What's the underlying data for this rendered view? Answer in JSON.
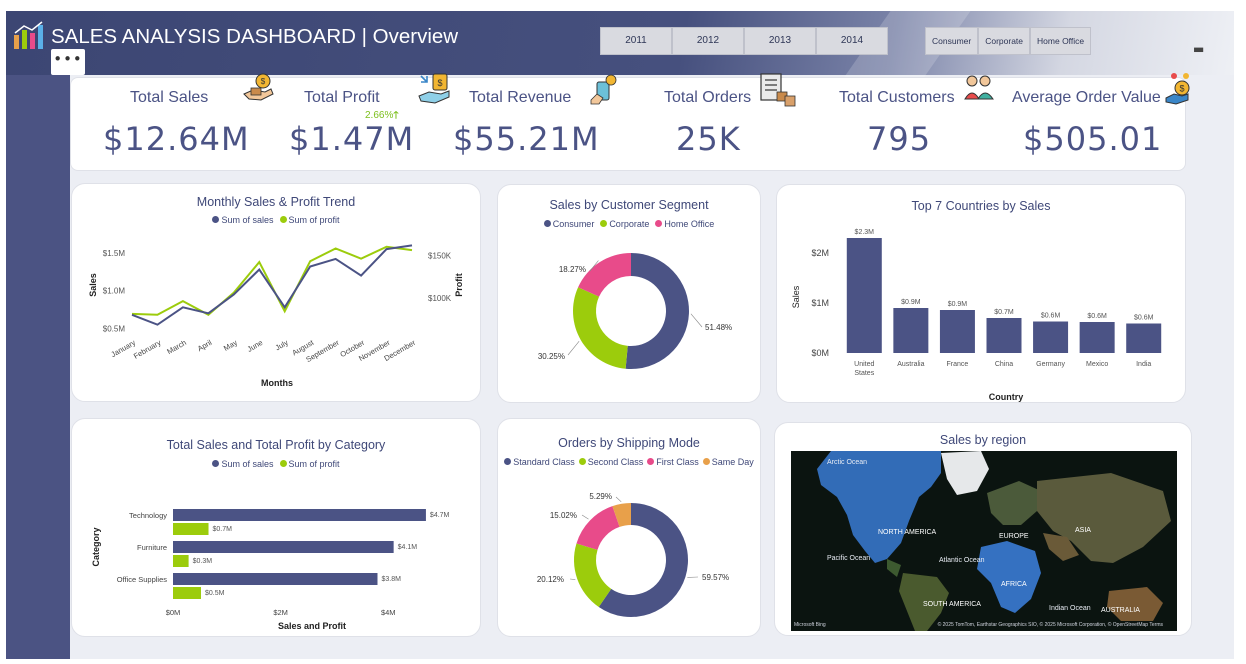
{
  "header": {
    "title": "SALES ANALYSIS DASHBOARD | Overview",
    "years": [
      "2011",
      "2012",
      "2013",
      "2014"
    ],
    "segments": [
      "Consumer",
      "Corporate",
      "Home Office"
    ],
    "more_label": "•••"
  },
  "kpis": [
    {
      "label": "Total Sales",
      "value": "$12.64M",
      "icon": "money-hand-icon"
    },
    {
      "label": "Total Profit",
      "value": "$1.47M",
      "delta": "2.66%",
      "delta_arrow": "🡑",
      "icon": "profit-icon"
    },
    {
      "label": "Total Revenue",
      "value": "$55.21M",
      "icon": "revenue-icon"
    },
    {
      "label": "Total Orders",
      "value": "25K",
      "icon": "orders-icon"
    },
    {
      "label": "Total Customers",
      "value": "795",
      "icon": "customers-icon"
    },
    {
      "label": "Average Order Value",
      "value": "$505.01",
      "icon": "avg-order-icon"
    }
  ],
  "colors": {
    "navy": "#4b5385",
    "green": "#9ccc0c",
    "pink": "#e84b8a",
    "orange": "#e8a04a",
    "accent_text": "#3f4878"
  },
  "chart_data": [
    {
      "type": "line",
      "title": "Monthly Sales & Profit Trend",
      "xlabel": "Months",
      "ylabel": "Sales",
      "y2label": "Profit",
      "categories": [
        "January",
        "February",
        "March",
        "April",
        "May",
        "June",
        "July",
        "August",
        "September",
        "October",
        "November",
        "December"
      ],
      "series": [
        {
          "name": "Sum of sales",
          "axis": "left",
          "values": [
            0.68,
            0.55,
            0.78,
            0.7,
            0.95,
            1.28,
            0.78,
            1.32,
            1.42,
            1.2,
            1.55,
            1.6
          ]
        },
        {
          "name": "Sum of profit",
          "axis": "right",
          "values": [
            81,
            80,
            96,
            80,
            106,
            142,
            84,
            143,
            158,
            146,
            160,
            156
          ]
        }
      ],
      "y_ticks": [
        "$0.5M",
        "$1.0M",
        "$1.5M"
      ],
      "ylim": [
        0.4,
        1.75
      ],
      "y2_ticks": [
        "$100K",
        "$150K"
      ],
      "y2lim": [
        55,
        175
      ]
    },
    {
      "type": "pie",
      "title": "Sales by Customer Segment",
      "categories": [
        "Consumer",
        "Corporate",
        "Home Office"
      ],
      "values": [
        51.48,
        30.25,
        18.27
      ],
      "labels": [
        "51.48%",
        "30.25%",
        "18.27%"
      ]
    },
    {
      "type": "bar",
      "title": "Top 7 Countries by Sales",
      "xlabel": "Country",
      "ylabel": "Sales",
      "categories": [
        "United States",
        "Australia",
        "France",
        "China",
        "Germany",
        "Mexico",
        "India"
      ],
      "category_lines": [
        [
          "United",
          "States"
        ],
        [
          "Australia"
        ],
        [
          "France"
        ],
        [
          "China"
        ],
        [
          "Germany"
        ],
        [
          "Mexico"
        ],
        [
          "India"
        ]
      ],
      "values": [
        2.3,
        0.9,
        0.86,
        0.7,
        0.63,
        0.62,
        0.59
      ],
      "labels": [
        "$2.3M",
        "$0.9M",
        "$0.9M",
        "$0.7M",
        "$0.6M",
        "$0.6M",
        "$0.6M"
      ],
      "y_ticks": [
        {
          "v": 0,
          "t": "$0M"
        },
        {
          "v": 1,
          "t": "$1M"
        },
        {
          "v": 2,
          "t": "$2M"
        }
      ],
      "ylim": [
        0,
        2.5
      ]
    },
    {
      "type": "bar",
      "orientation": "horizontal",
      "title": "Total Sales and Total Profit by Category",
      "xlabel": "Sales and Profit",
      "ylabel": "Category",
      "categories": [
        "Technology",
        "Furniture",
        "Office Supplies"
      ],
      "series": [
        {
          "name": "Sum of sales",
          "values": [
            4.7,
            4.1,
            3.8
          ],
          "labels": [
            "$4.7M",
            "$4.1M",
            "$3.8M"
          ]
        },
        {
          "name": "Sum of profit",
          "values": [
            0.66,
            0.29,
            0.52
          ],
          "labels": [
            "$0.7M",
            "$0.3M",
            "$0.5M"
          ]
        }
      ],
      "x_ticks": [
        {
          "v": 0,
          "t": "$0M"
        },
        {
          "v": 2,
          "t": "$2M"
        },
        {
          "v": 4,
          "t": "$4M"
        }
      ],
      "xlim": [
        0,
        4.85
      ]
    },
    {
      "type": "pie",
      "title": "Orders by Shipping Mode",
      "categories": [
        "Standard Class",
        "Second Class",
        "First Class",
        "Same Day"
      ],
      "values": [
        59.57,
        20.12,
        15.02,
        5.29
      ],
      "labels": [
        "59.57%",
        "20.12%",
        "15.02%",
        "5.29%"
      ]
    }
  ],
  "map": {
    "title": "Sales by region",
    "labels": [
      "Arctic Ocean",
      "NORTH AMERICA",
      "EUROPE",
      "ASIA",
      "Pacific Ocean",
      "Atlantic Ocean",
      "AFRICA",
      "SOUTH AMERICA",
      "Indian Ocean",
      "AUSTRALIA"
    ],
    "attribution": "© 2025 TomTom, Earthstar Geographics SIO, © 2025 Microsoft Corporation, © OpenStreetMap  Terms",
    "provider": "Microsoft Bing"
  }
}
